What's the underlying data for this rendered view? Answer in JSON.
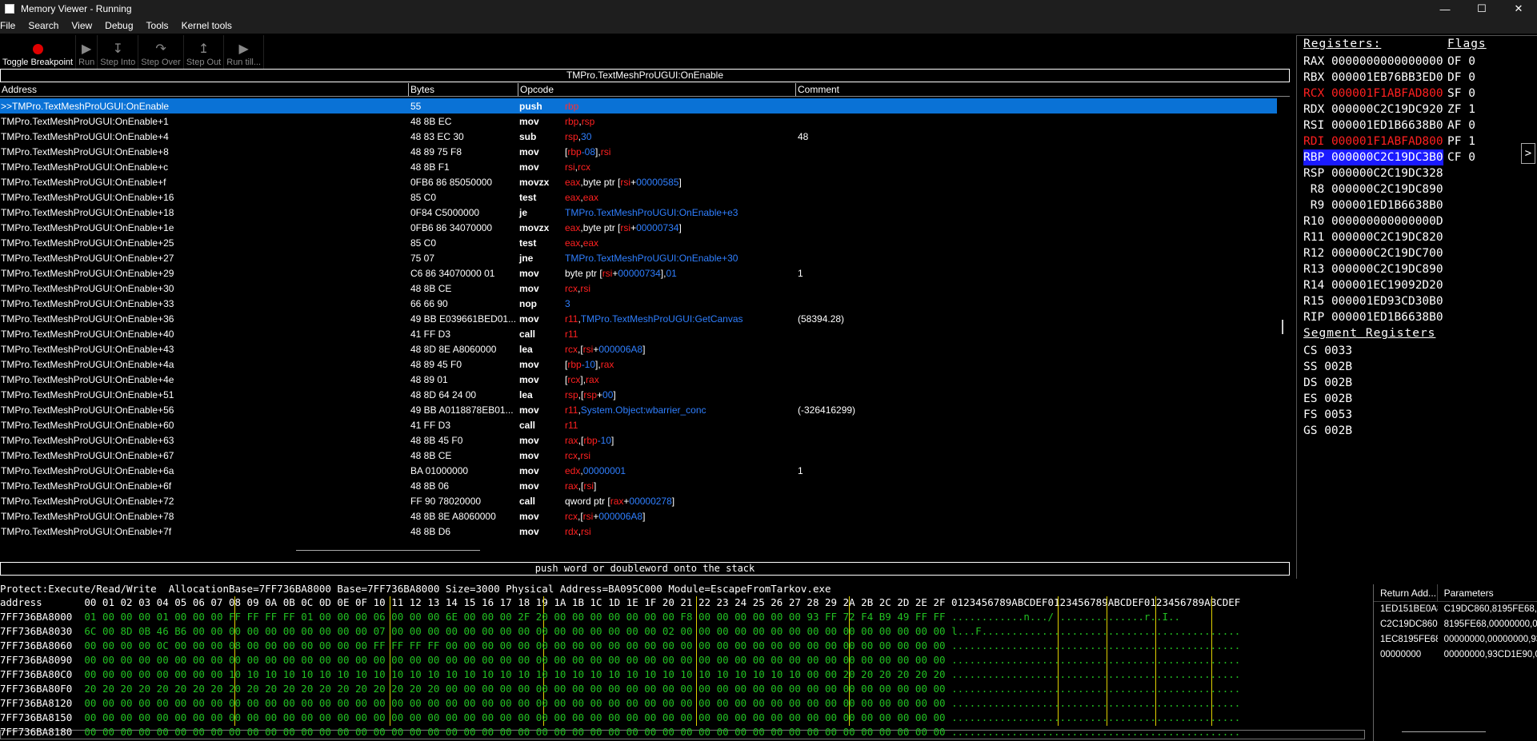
{
  "window": {
    "title": "Memory Viewer - Running"
  },
  "menu": [
    "File",
    "Search",
    "View",
    "Debug",
    "Tools",
    "Kernel tools"
  ],
  "toolbar": {
    "toggle_breakpoint": "Toggle Breakpoint",
    "run": "Run",
    "step_into": "Step Into",
    "step_over": "Step Over",
    "step_out": "Step Out",
    "run_till": "Run till..."
  },
  "disassembler": {
    "function_name": "TMPro.TextMeshProUGUI:OnEnable",
    "columns": {
      "address": "Address",
      "bytes": "Bytes",
      "opcode": "Opcode",
      "comment": "Comment"
    },
    "rows": [
      {
        "addr": ">>TMPro.TextMeshProUGUI:OnEnable",
        "bytes": "55",
        "op": "push",
        "args": [
          [
            "rbp",
            "r"
          ]
        ],
        "comment": "",
        "selected": true
      },
      {
        "addr": "TMPro.TextMeshProUGUI:OnEnable+1",
        "bytes": "48 8B EC",
        "op": "mov",
        "args": [
          [
            "rbp",
            "r"
          ],
          [
            ",",
            "w"
          ],
          [
            "rsp",
            "r"
          ]
        ],
        "comment": ""
      },
      {
        "addr": "TMPro.TextMeshProUGUI:OnEnable+4",
        "bytes": "48 83 EC 30",
        "op": "sub",
        "args": [
          [
            "rsp",
            "r"
          ],
          [
            ",",
            "w"
          ],
          [
            "30",
            "b"
          ]
        ],
        "comment": "48"
      },
      {
        "addr": "TMPro.TextMeshProUGUI:OnEnable+8",
        "bytes": "48 89 75 F8",
        "op": "mov",
        "args": [
          [
            "[",
            "w"
          ],
          [
            "rbp",
            "r"
          ],
          [
            "-08",
            "b"
          ],
          [
            "]",
            "w"
          ],
          [
            ",",
            "w"
          ],
          [
            "rsi",
            "r"
          ]
        ],
        "comment": ""
      },
      {
        "addr": "TMPro.TextMeshProUGUI:OnEnable+c",
        "bytes": "48 8B F1",
        "op": "mov",
        "args": [
          [
            "rsi",
            "r"
          ],
          [
            ",",
            "w"
          ],
          [
            "rcx",
            "r"
          ]
        ],
        "comment": ""
      },
      {
        "addr": "TMPro.TextMeshProUGUI:OnEnable+f",
        "bytes": "0FB6 86 85050000",
        "op": "movzx",
        "args": [
          [
            "eax",
            "r"
          ],
          [
            ",byte ptr [",
            "w"
          ],
          [
            "rsi",
            "r"
          ],
          [
            "+",
            "w"
          ],
          [
            "00000585",
            "b"
          ],
          [
            "]",
            "w"
          ]
        ],
        "comment": ""
      },
      {
        "addr": "TMPro.TextMeshProUGUI:OnEnable+16",
        "bytes": "85 C0",
        "op": "test",
        "args": [
          [
            "eax",
            "r"
          ],
          [
            ",",
            "w"
          ],
          [
            "eax",
            "r"
          ]
        ],
        "comment": ""
      },
      {
        "addr": "TMPro.TextMeshProUGUI:OnEnable+18",
        "bytes": "0F84 C5000000",
        "op": "je",
        "args": [
          [
            "TMPro.TextMeshProUGUI:OnEnable+e3",
            "b"
          ]
        ],
        "comment": ""
      },
      {
        "addr": "TMPro.TextMeshProUGUI:OnEnable+1e",
        "bytes": "0FB6 86 34070000",
        "op": "movzx",
        "args": [
          [
            "eax",
            "r"
          ],
          [
            ",byte ptr [",
            "w"
          ],
          [
            "rsi",
            "r"
          ],
          [
            "+",
            "w"
          ],
          [
            "00000734",
            "b"
          ],
          [
            "]",
            "w"
          ]
        ],
        "comment": ""
      },
      {
        "addr": "TMPro.TextMeshProUGUI:OnEnable+25",
        "bytes": "85 C0",
        "op": "test",
        "args": [
          [
            "eax",
            "r"
          ],
          [
            ",",
            "w"
          ],
          [
            "eax",
            "r"
          ]
        ],
        "comment": ""
      },
      {
        "addr": "TMPro.TextMeshProUGUI:OnEnable+27",
        "bytes": "75 07",
        "op": "jne",
        "args": [
          [
            "TMPro.TextMeshProUGUI:OnEnable+30",
            "b"
          ]
        ],
        "comment": ""
      },
      {
        "addr": "TMPro.TextMeshProUGUI:OnEnable+29",
        "bytes": "C6 86 34070000 01",
        "op": "mov",
        "args": [
          [
            "byte ptr [",
            "w"
          ],
          [
            "rsi",
            "r"
          ],
          [
            "+",
            "w"
          ],
          [
            "00000734",
            "b"
          ],
          [
            "]",
            "w"
          ],
          [
            ",",
            "w"
          ],
          [
            "01",
            "b"
          ]
        ],
        "comment": "1"
      },
      {
        "addr": "TMPro.TextMeshProUGUI:OnEnable+30",
        "bytes": "48 8B CE",
        "op": "mov",
        "args": [
          [
            "rcx",
            "r"
          ],
          [
            ",",
            "w"
          ],
          [
            "rsi",
            "r"
          ]
        ],
        "comment": ""
      },
      {
        "addr": "TMPro.TextMeshProUGUI:OnEnable+33",
        "bytes": "66 66 90",
        "op": "nop",
        "args": [
          [
            "3",
            "b"
          ]
        ],
        "comment": ""
      },
      {
        "addr": "TMPro.TextMeshProUGUI:OnEnable+36",
        "bytes": "49 BB E039661BED01...",
        "op": "mov",
        "args": [
          [
            "r11",
            "r"
          ],
          [
            ",",
            "w"
          ],
          [
            "TMPro.TextMeshProUGUI:GetCanvas",
            "b"
          ]
        ],
        "comment": "(58394.28)"
      },
      {
        "addr": "TMPro.TextMeshProUGUI:OnEnable+40",
        "bytes": "41 FF D3",
        "op": "call",
        "args": [
          [
            "r11",
            "r"
          ]
        ],
        "comment": ""
      },
      {
        "addr": "TMPro.TextMeshProUGUI:OnEnable+43",
        "bytes": "48 8D 8E A8060000",
        "op": "lea",
        "args": [
          [
            "rcx",
            "r"
          ],
          [
            ",[",
            "w"
          ],
          [
            "rsi",
            "r"
          ],
          [
            "+",
            "w"
          ],
          [
            "000006A8",
            "b"
          ],
          [
            "]",
            "w"
          ]
        ],
        "comment": ""
      },
      {
        "addr": "TMPro.TextMeshProUGUI:OnEnable+4a",
        "bytes": "48 89 45 F0",
        "op": "mov",
        "args": [
          [
            "[",
            "w"
          ],
          [
            "rbp",
            "r"
          ],
          [
            "-10",
            "b"
          ],
          [
            "]",
            "w"
          ],
          [
            ",",
            "w"
          ],
          [
            "rax",
            "r"
          ]
        ],
        "comment": ""
      },
      {
        "addr": "TMPro.TextMeshProUGUI:OnEnable+4e",
        "bytes": "48 89 01",
        "op": "mov",
        "args": [
          [
            "[",
            "w"
          ],
          [
            "rcx",
            "r"
          ],
          [
            "]",
            "w"
          ],
          [
            ",",
            "w"
          ],
          [
            "rax",
            "r"
          ]
        ],
        "comment": ""
      },
      {
        "addr": "TMPro.TextMeshProUGUI:OnEnable+51",
        "bytes": "48 8D 64 24 00",
        "op": "lea",
        "args": [
          [
            "rsp",
            "r"
          ],
          [
            ",[",
            "w"
          ],
          [
            "rsp",
            "r"
          ],
          [
            "+",
            "w"
          ],
          [
            "00",
            "b"
          ],
          [
            "]",
            "w"
          ]
        ],
        "comment": ""
      },
      {
        "addr": "TMPro.TextMeshProUGUI:OnEnable+56",
        "bytes": "49 BB A0118878EB01...",
        "op": "mov",
        "args": [
          [
            "r11",
            "r"
          ],
          [
            ",",
            "w"
          ],
          [
            "System.Object:wbarrier_conc",
            "b"
          ]
        ],
        "comment": "(-326416299)"
      },
      {
        "addr": "TMPro.TextMeshProUGUI:OnEnable+60",
        "bytes": "41 FF D3",
        "op": "call",
        "args": [
          [
            "r11",
            "r"
          ]
        ],
        "comment": ""
      },
      {
        "addr": "TMPro.TextMeshProUGUI:OnEnable+63",
        "bytes": "48 8B 45 F0",
        "op": "mov",
        "args": [
          [
            "rax",
            "r"
          ],
          [
            ",[",
            "w"
          ],
          [
            "rbp",
            "r"
          ],
          [
            "-10",
            "b"
          ],
          [
            "]",
            "w"
          ]
        ],
        "comment": ""
      },
      {
        "addr": "TMPro.TextMeshProUGUI:OnEnable+67",
        "bytes": "48 8B CE",
        "op": "mov",
        "args": [
          [
            "rcx",
            "r"
          ],
          [
            ",",
            "w"
          ],
          [
            "rsi",
            "r"
          ]
        ],
        "comment": ""
      },
      {
        "addr": "TMPro.TextMeshProUGUI:OnEnable+6a",
        "bytes": "BA 01000000",
        "op": "mov",
        "args": [
          [
            "edx",
            "r"
          ],
          [
            ",",
            "w"
          ],
          [
            "00000001",
            "b"
          ]
        ],
        "comment": "1"
      },
      {
        "addr": "TMPro.TextMeshProUGUI:OnEnable+6f",
        "bytes": "48 8B 06",
        "op": "mov",
        "args": [
          [
            "rax",
            "r"
          ],
          [
            ",[",
            "w"
          ],
          [
            "rsi",
            "r"
          ],
          [
            "]",
            "w"
          ]
        ],
        "comment": ""
      },
      {
        "addr": "TMPro.TextMeshProUGUI:OnEnable+72",
        "bytes": "FF 90 78020000",
        "op": "call",
        "args": [
          [
            "qword ptr [",
            "w"
          ],
          [
            "rax",
            "r"
          ],
          [
            "+",
            "w"
          ],
          [
            "00000278",
            "b"
          ],
          [
            "]",
            "w"
          ]
        ],
        "comment": ""
      },
      {
        "addr": "TMPro.TextMeshProUGUI:OnEnable+78",
        "bytes": "48 8B 8E A8060000",
        "op": "mov",
        "args": [
          [
            "rcx",
            "r"
          ],
          [
            ",[",
            "w"
          ],
          [
            "rsi",
            "r"
          ],
          [
            "+",
            "w"
          ],
          [
            "000006A8",
            "b"
          ],
          [
            "]",
            "w"
          ]
        ],
        "comment": ""
      },
      {
        "addr": "TMPro.TextMeshProUGUI:OnEnable+7f",
        "bytes": "48 8B D6",
        "op": "mov",
        "args": [
          [
            "rdx",
            "r"
          ],
          [
            ",",
            "w"
          ],
          [
            "rsi",
            "r"
          ]
        ],
        "comment": ""
      }
    ],
    "status": "push word or doubleword onto the stack"
  },
  "registers": {
    "title": "Registers:",
    "list": [
      {
        "name": "RAX",
        "value": "0000000000000000",
        "state": "normal"
      },
      {
        "name": "RBX",
        "value": "000001EB76BB3ED0",
        "state": "normal"
      },
      {
        "name": "RCX",
        "value": "000001F1ABFAD800",
        "state": "changed"
      },
      {
        "name": "RDX",
        "value": "000000C2C19DC920",
        "state": "normal"
      },
      {
        "name": "RSI",
        "value": "000001ED1B6638B0",
        "state": "normal"
      },
      {
        "name": "RDI",
        "value": "000001F1ABFAD800",
        "state": "changed"
      },
      {
        "name": "RBP",
        "value": "000000C2C19DC3B0",
        "state": "selected"
      },
      {
        "name": "RSP",
        "value": "000000C2C19DC328",
        "state": "normal"
      },
      {
        "name": " R8",
        "value": "000000C2C19DC890",
        "state": "normal"
      },
      {
        "name": " R9",
        "value": "000001ED1B6638B0",
        "state": "normal"
      },
      {
        "name": "R10",
        "value": "000000000000000D",
        "state": "normal"
      },
      {
        "name": "R11",
        "value": "000000C2C19DC820",
        "state": "normal"
      },
      {
        "name": "R12",
        "value": "000000C2C19DC700",
        "state": "normal"
      },
      {
        "name": "R13",
        "value": "000000C2C19DC890",
        "state": "normal"
      },
      {
        "name": "R14",
        "value": "000001EC19092D20",
        "state": "normal"
      },
      {
        "name": "R15",
        "value": "000001ED93CD30B0",
        "state": "normal"
      },
      {
        "name": "RIP",
        "value": "000001ED1B6638B0",
        "state": "normal"
      }
    ],
    "flags_title": "Flags",
    "flags": [
      {
        "name": "OF",
        "value": "0"
      },
      {
        "name": "DF",
        "value": "0"
      },
      {
        "name": "SF",
        "value": "0"
      },
      {
        "name": "ZF",
        "value": "1"
      },
      {
        "name": "AF",
        "value": "0"
      },
      {
        "name": "PF",
        "value": "1"
      },
      {
        "name": "CF",
        "value": "0"
      }
    ],
    "segment_title": "Segment Registers",
    "segments": [
      {
        "name": "CS",
        "value": "0033"
      },
      {
        "name": "SS",
        "value": "002B"
      },
      {
        "name": "DS",
        "value": "002B"
      },
      {
        "name": "ES",
        "value": "002B"
      },
      {
        "name": "FS",
        "value": "0053"
      },
      {
        "name": "GS",
        "value": "002B"
      }
    ],
    "expand_label": ">"
  },
  "hexview": {
    "info": "Protect:Execute/Read/Write  AllocationBase=7FF736BA8000 Base=7FF736BA8000 Size=3000 Physical Address=BA095C000 Module=EscapeFromTarkov.exe",
    "header": "address       00 01 02 03 04 05 06 07 08 09 0A 0B 0C 0D 0E 0F 10 11 12 13 14 15 16 17 18 19 1A 1B 1C 1D 1E 1F 20 21 22 23 24 25 26 27 28 29 2A 2B 2C 2D 2E 2F 0123456789ABCDEF0123456789ABCDEF0123456789ABCDEF",
    "lines": [
      {
        "addr": "7FF736BA8000",
        "bytes": "01 00 00 00 01 00 00 00 FF FF FF FF 01 00 00 00 06 00 00 00 6E 00 00 00 2F 20 00 00 00 00 00 00 00 F8 00 00 00 00 00 00 93 FF 72 F4 B9 49 FF FF",
        "ascii": "............n.../ ..............r..I.."
      },
      {
        "addr": "7FF736BA8030",
        "bytes": "6C 00 8D 0B 46 B6 00 00 00 00 00 00 00 00 00 00 07 00 00 00 00 00 00 00 00 00 00 00 00 00 00 00 02 00 00 00 00 00 00 00 00 00 00 00 00 00 00 00",
        "ascii": "l...F..........................................."
      },
      {
        "addr": "7FF736BA8060",
        "bytes": "00 00 00 00 0C 00 00 00 08 00 00 00 00 00 00 00 FF FF FF FF 00 00 00 00 00 00 00 00 00 00 00 00 00 00 00 00 00 00 00 00 00 00 00 00 00 00 00 00",
        "ascii": "................................................"
      },
      {
        "addr": "7FF736BA8090",
        "bytes": "00 00 00 00 00 00 00 00 00 00 00 00 00 00 00 00 00 00 00 00 00 00 00 00 00 00 00 00 00 00 00 00 00 00 00 00 00 00 00 00 00 00 00 00 00 00 00 00",
        "ascii": "................................................"
      },
      {
        "addr": "7FF736BA80C0",
        "bytes": "00 00 00 00 00 00 00 00 10 10 10 10 10 10 10 10 10 10 10 10 10 10 10 10 10 10 10 10 10 10 10 10 10 10 10 10 10 10 10 10 00 00 20 20 20 20 20 20",
        "ascii": "................................................"
      },
      {
        "addr": "7FF736BA80F0",
        "bytes": "20 20 20 20 20 20 20 20 20 20 20 20 20 20 20 20 20 20 20 20 00 00 00 00 00 00 00 00 00 00 00 00 00 00 00 00 00 00 00 00 00 00 00 00 00 00 00 00",
        "ascii": "................................................"
      },
      {
        "addr": "7FF736BA8120",
        "bytes": "00 00 00 00 00 00 00 00 00 00 00 00 00 00 00 00 00 00 00 00 00 00 00 00 00 00 00 00 00 00 00 00 00 00 00 00 00 00 00 00 00 00 00 00 00 00 00 00",
        "ascii": "................................................"
      },
      {
        "addr": "7FF736BA8150",
        "bytes": "00 00 00 00 00 00 00 00 00 00 00 00 00 00 00 00 00 00 00 00 00 00 00 00 00 00 00 00 00 00 00 00 00 00 00 00 00 00 00 00 00 00 00 00 00 00 00 00",
        "ascii": "................................................"
      },
      {
        "addr": "7FF736BA8180",
        "bytes": "00 00 00 00 00 00 00 00 00 00 00 00 00 00 00 00 00 00 00 00 00 00 00 00 00 00 00 00 00 00 00 00 00 00 00 00 00 00 00 00 00 00 00 00 00 00 00 00",
        "ascii": "................................................"
      }
    ]
  },
  "stack": {
    "columns": {
      "return": "Return Add...",
      "params": "Parameters"
    },
    "rows": [
      {
        "ret": "1ED151BE0A8",
        "params": "C19DC860,8195FE68,0"
      },
      {
        "ret": "C2C19DC860",
        "params": "8195FE68,00000000,00"
      },
      {
        "ret": "1EC8195FE68",
        "params": "00000000,00000000,93"
      },
      {
        "ret": "00000000",
        "params": "00000000,93CD1E90,0("
      }
    ]
  }
}
